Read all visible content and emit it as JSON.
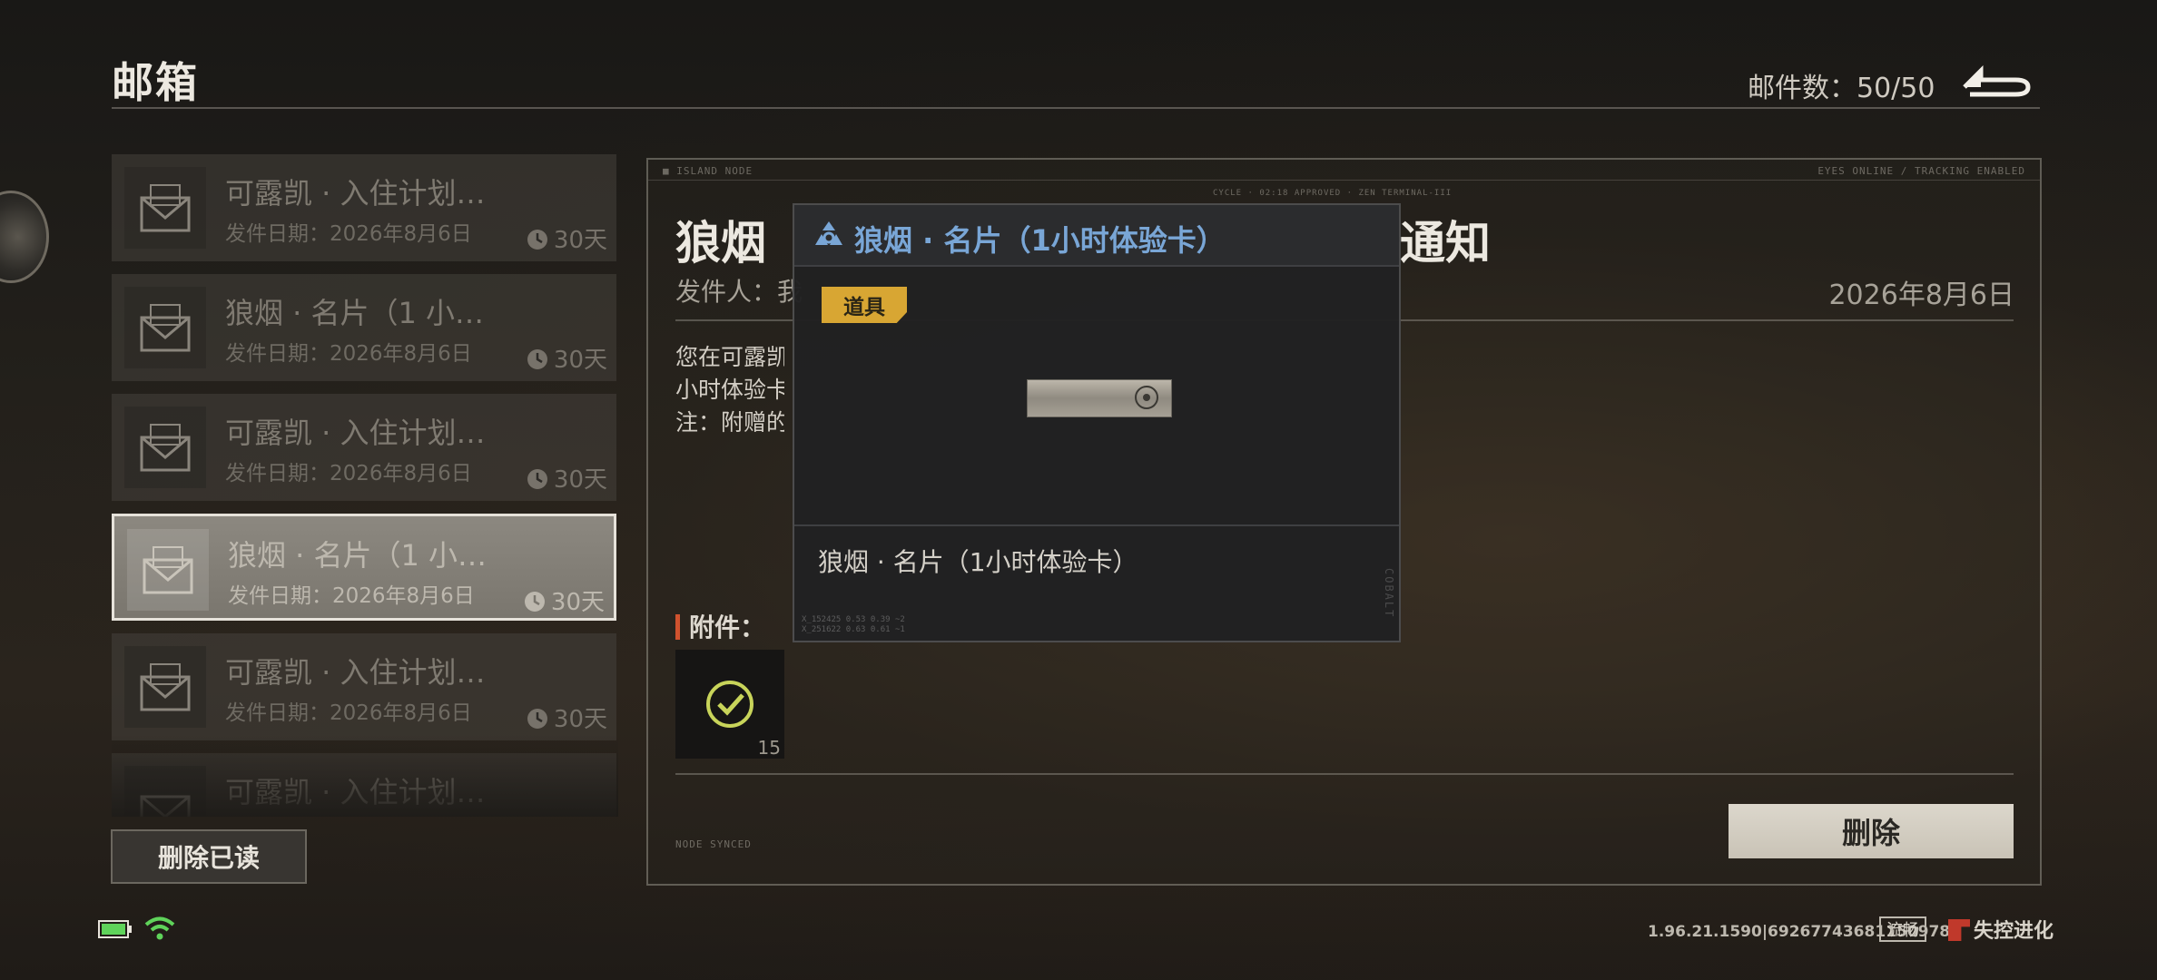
{
  "header": {
    "title": "邮箱",
    "mail_count_label": "邮件数：50/50"
  },
  "mail_list": {
    "items": [
      {
        "subject": "可露凯 · 入住计划…",
        "date": "发件日期：2026年8月6日",
        "expiry": "30天",
        "selected": false
      },
      {
        "subject": "狼烟 · 名片（1 小…",
        "date": "发件日期：2026年8月6日",
        "expiry": "30天",
        "selected": false
      },
      {
        "subject": "可露凯 · 入住计划…",
        "date": "发件日期：2026年8月6日",
        "expiry": "30天",
        "selected": false
      },
      {
        "subject": "狼烟 · 名片（1 小…",
        "date": "发件日期：2026年8月6日",
        "expiry": "30天",
        "selected": true
      },
      {
        "subject": "可露凯 · 入住计划…",
        "date": "发件日期：2026年8月6日",
        "expiry": "30天",
        "selected": false
      },
      {
        "subject": "可露凯 · 入住计划…",
        "date": "",
        "expiry": "",
        "selected": false
      }
    ],
    "delete_read_label": "删除已读"
  },
  "detail": {
    "title_start": "狼烟",
    "title_end": "通知",
    "sender_label": "发件人：我",
    "date": "2026年8月6日",
    "body_lines": [
      "您在可露凯",
      "小时体验卡",
      "注：附赠的"
    ],
    "attachments_label": "附件：",
    "attachment_qty": "15",
    "delete_label": "删除",
    "tiny_top_left": "■ ISLAND NODE",
    "tiny_top_mid": "CYCLE · 02:18 APPROVED · ZEN TERMINAL-III",
    "tiny_top_right": "EYES ONLINE / TRACKING ENABLED",
    "tiny_bottom_left": "NODE SYNCED"
  },
  "popup": {
    "title": "狼烟 · 名片（1小时体验卡）",
    "tag": "道具",
    "description": "狼烟 · 名片（1小时体验卡）",
    "footer_code_1": "X_152425   0.53   0.39   ~2",
    "footer_code_2": "X_251622   0.63   0.61   ~1",
    "side_text": "COBALT"
  },
  "status_bar": {
    "version": "1.96.21.1590|69267743681150978",
    "quality": "流畅",
    "brand": "失控进化"
  },
  "colors": {
    "accent_blue": "#79a6d6",
    "tag_gold": "#d8a633",
    "attach_marker": "#d0522e",
    "check_green": "#c8d45a",
    "battery_green": "#5fd35a"
  }
}
